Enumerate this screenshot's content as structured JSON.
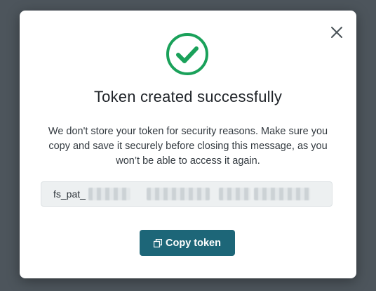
{
  "modal": {
    "title": "Token created successfully",
    "description": "We don't store your token for security reasons. Make sure you copy and save it securely before closing this message, as you won’t be able to access it again.",
    "token_prefix": "fs_pat_",
    "copy_button_label": "Copy token",
    "icons": {
      "close": "close-icon",
      "success": "check-circle-icon",
      "copy": "copy-icon"
    }
  },
  "colors": {
    "backdrop": "#4d555c",
    "success_green": "#1aa15a",
    "button_bg": "#1d6678",
    "token_bg": "#edf0f1"
  }
}
